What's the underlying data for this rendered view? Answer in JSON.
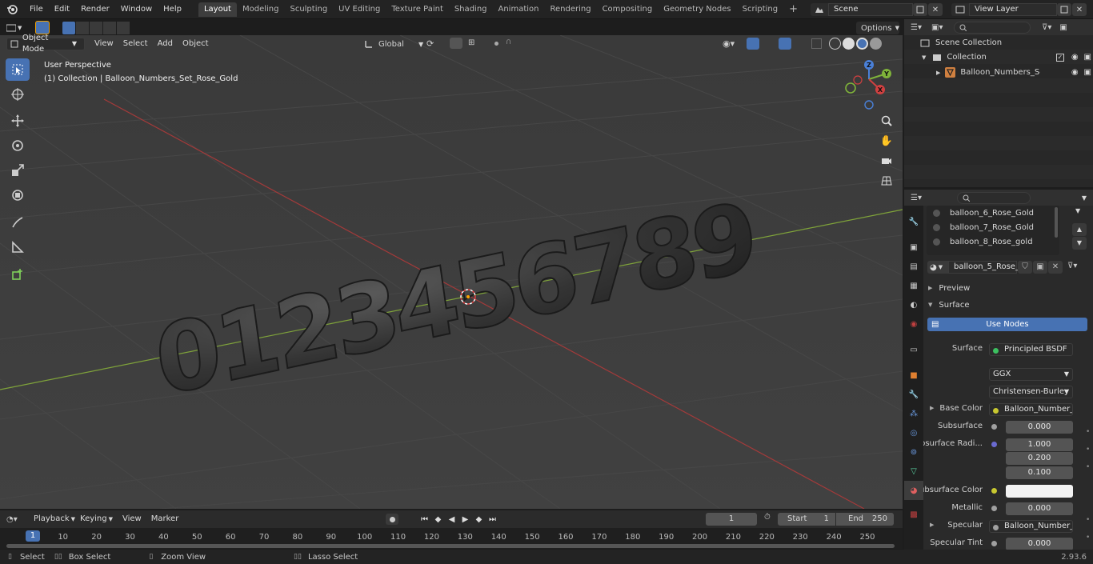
{
  "topbar": {
    "menus": [
      "File",
      "Edit",
      "Render",
      "Window",
      "Help"
    ],
    "workspaces": [
      "Layout",
      "Modeling",
      "Sculpting",
      "UV Editing",
      "Texture Paint",
      "Shading",
      "Animation",
      "Rendering",
      "Compositing",
      "Geometry Nodes",
      "Scripting"
    ],
    "active_workspace": "Layout",
    "add_tab": "+",
    "scene": "Scene",
    "view_layer": "View Layer"
  },
  "viewport_header": {
    "mode": "Object Mode",
    "menus": [
      "View",
      "Select",
      "Add",
      "Object"
    ],
    "transform_orientation": "Global",
    "options": "Options"
  },
  "viewport": {
    "perspective": "User Perspective",
    "collection_info": "(1) Collection | Balloon_Numbers_Set_Rose_Gold",
    "digits": [
      "0",
      "1",
      "2",
      "3",
      "4",
      "5",
      "6",
      "7",
      "8",
      "9"
    ],
    "gizmo": {
      "z": "Z",
      "y": "Y",
      "x": "X"
    }
  },
  "outliner": {
    "scene_collection": "Scene Collection",
    "collection": "Collection",
    "object": "Balloon_Numbers_Set_Ro"
  },
  "properties": {
    "materials": [
      "balloon_6_Rose_Gold",
      "balloon_7_Rose_Gold",
      "balloon_8_Rose_gold"
    ],
    "material_name": "balloon_5_Rose_...",
    "preview": "Preview",
    "surface_panel": "Surface",
    "use_nodes": "Use Nodes",
    "surface_label": "Surface",
    "surface_value": "Principled BSDF",
    "distribution": "GGX",
    "subsurface_method": "Christensen-Burley",
    "base_color_label": "Base Color",
    "base_color_value": "Balloon_Number_Se...",
    "subsurface_label": "Subsurface",
    "subsurface_value": "0.000",
    "subsurface_radius_label": "Subsurface Radi...",
    "subsurface_radius": [
      "1.000",
      "0.200",
      "0.100"
    ],
    "subsurface_color_label": "Subsurface Color",
    "metallic_label": "Metallic",
    "metallic_value": "0.000",
    "specular_label": "Specular",
    "specular_value": "Balloon_Number_Se...",
    "specular_tint_label": "Specular Tint",
    "specular_tint_value": "0.000"
  },
  "timeline": {
    "menus": [
      "Playback",
      "Keying",
      "View",
      "Marker"
    ],
    "current_frame": "1",
    "start_label": "Start",
    "start_value": "1",
    "end_label": "End",
    "end_value": "250",
    "ticks": [
      "1",
      "10",
      "20",
      "30",
      "40",
      "50",
      "60",
      "70",
      "80",
      "90",
      "100",
      "110",
      "120",
      "130",
      "140",
      "150",
      "160",
      "170",
      "180",
      "190",
      "200",
      "210",
      "220",
      "230",
      "240",
      "250"
    ]
  },
  "statusbar": {
    "select": "Select",
    "box_select": "Box Select",
    "zoom_view": "Zoom View",
    "lasso_select": "Lasso Select",
    "version": "2.93.6"
  },
  "colors": {
    "accent": "#4772b3",
    "x_axis": "#a33a3a",
    "y_axis": "#7fa33a",
    "balloon": "#2f2f2f"
  }
}
